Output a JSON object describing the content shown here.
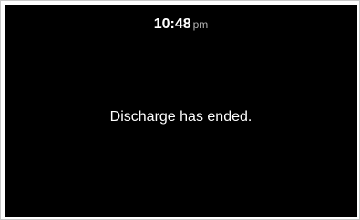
{
  "status_bar": {
    "time": "10:48",
    "period": "pm"
  },
  "main": {
    "message": "Discharge has ended."
  },
  "colors": {
    "background": "#000000",
    "text": "#ffffff",
    "period_text": "#b3b3b3",
    "border": "#c8c8c8"
  }
}
